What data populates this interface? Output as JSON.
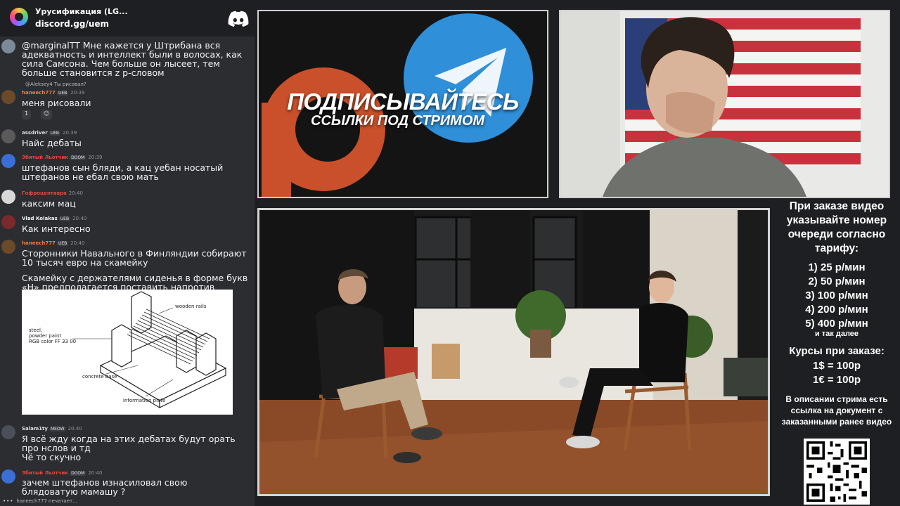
{
  "discord": {
    "server_name": "Урусификация (LG...",
    "invite": "discord.gg/uem"
  },
  "messages": [
    {
      "id": "m1",
      "text": "@marginalTT Мне кажется у Штрибана вся адекватность и интеллект были в волосах, как сила Самсона. Чем больше он лысеет, тем больше становится z p-словом",
      "avatar_color": "#7a8a99"
    },
    {
      "id": "m2",
      "reply_to": "@Aleksey4 Ты рисовал?",
      "author": "haneech777",
      "author_color": "#f07f3a",
      "tags": [
        "UEB"
      ],
      "time": "20:39",
      "text": "меня рисовали",
      "reactions": [
        "1",
        "😐"
      ],
      "avatar_color": "#6b4a2a"
    },
    {
      "id": "m3",
      "author": "assdriver",
      "author_color": "#dbdee1",
      "tags": [
        "UEB"
      ],
      "time": "20:39",
      "text": "Найс дебаты",
      "avatar_color": "#5a5a5a"
    },
    {
      "id": "m4",
      "author": "Збитый Льотчик",
      "author_color": "#e8453c",
      "tags": [
        "DOOM"
      ],
      "time": "20:39",
      "text": "штефанов сын бляди, а кац уебан носатый штефанов не ебал свою мать",
      "avatar_color": "#3b6fd6"
    },
    {
      "id": "m5",
      "author": "Гофроцентавра",
      "author_color": "#e8453c",
      "tags": [],
      "time": "20:40",
      "text": "каксим мац",
      "avatar_color": "#d8d8d8"
    },
    {
      "id": "m6",
      "author": "Vlad Kolakas",
      "author_color": "#f2f3f5",
      "tags": [
        "UEB"
      ],
      "time": "20:40",
      "text": "Как интересно",
      "avatar_color": "#7a2a2a"
    },
    {
      "id": "m7",
      "author": "haneech777",
      "author_color": "#f07f3a",
      "tags": [
        "UEB"
      ],
      "time": "20:40",
      "text": "Сторонники Навального в Финляндии собирают 10 тысяч евро на скамейку",
      "text2": "Скамейку с держателями сиденья в форме букв «Н» предполагается поставить напротив посольства РФ.",
      "avatar_color": "#6b4a2a"
    },
    {
      "id": "m8",
      "author": "Salam1ty",
      "author_color": "#dbdee1",
      "tags": [
        "MEOW"
      ],
      "time": "20:40",
      "text": "Я всё жду когда на этих дебатах будут орать про нслов и тд",
      "text2": "Чё то скучно",
      "avatar_color": "#4a4f5a"
    },
    {
      "id": "m9",
      "author": "Збитый Льотчик",
      "author_color": "#e8453c",
      "tags": [
        "DOOM"
      ],
      "time": "20:40",
      "text": "зачем штефанов изнасиловал свою блядоватую мамашу ?",
      "avatar_color": "#3b6fd6"
    }
  ],
  "bench_labels": {
    "rails": "wooden rails",
    "steel_1": "steel,",
    "steel_2": "powder paint",
    "steel_3": "RGB color FF 33 00",
    "base": "concrete base",
    "plate": "information plate"
  },
  "typing": "haneech777 печатает...",
  "banner": {
    "title": "ПОДПИСЫВАЙТЕСЬ",
    "subtitle": "ССЫЛКИ ПОД СТРИМОМ",
    "telegram_color": "#2f8fd8",
    "boosty_color": "#e0552a"
  },
  "info": {
    "heading": "При заказе видео указывайте номер очереди согласно тарифу:",
    "tariffs": [
      "1) 25 р/мин",
      "2) 50 р/мин",
      "3) 100 р/мин",
      "4) 200 р/мин",
      "5) 400 р/мин"
    ],
    "tariffs_more": "и так далее",
    "rates_heading": "Курсы при заказе:",
    "rate_usd": "1$ = 100р",
    "rate_eur": "1€ = 100р",
    "description_note": "В описании стрима есть ссылка на документ с заказанными ранее видео"
  },
  "icons": {
    "discord": "discord-logo-icon",
    "server": "server-icon",
    "qr": "qr-code-icon"
  }
}
